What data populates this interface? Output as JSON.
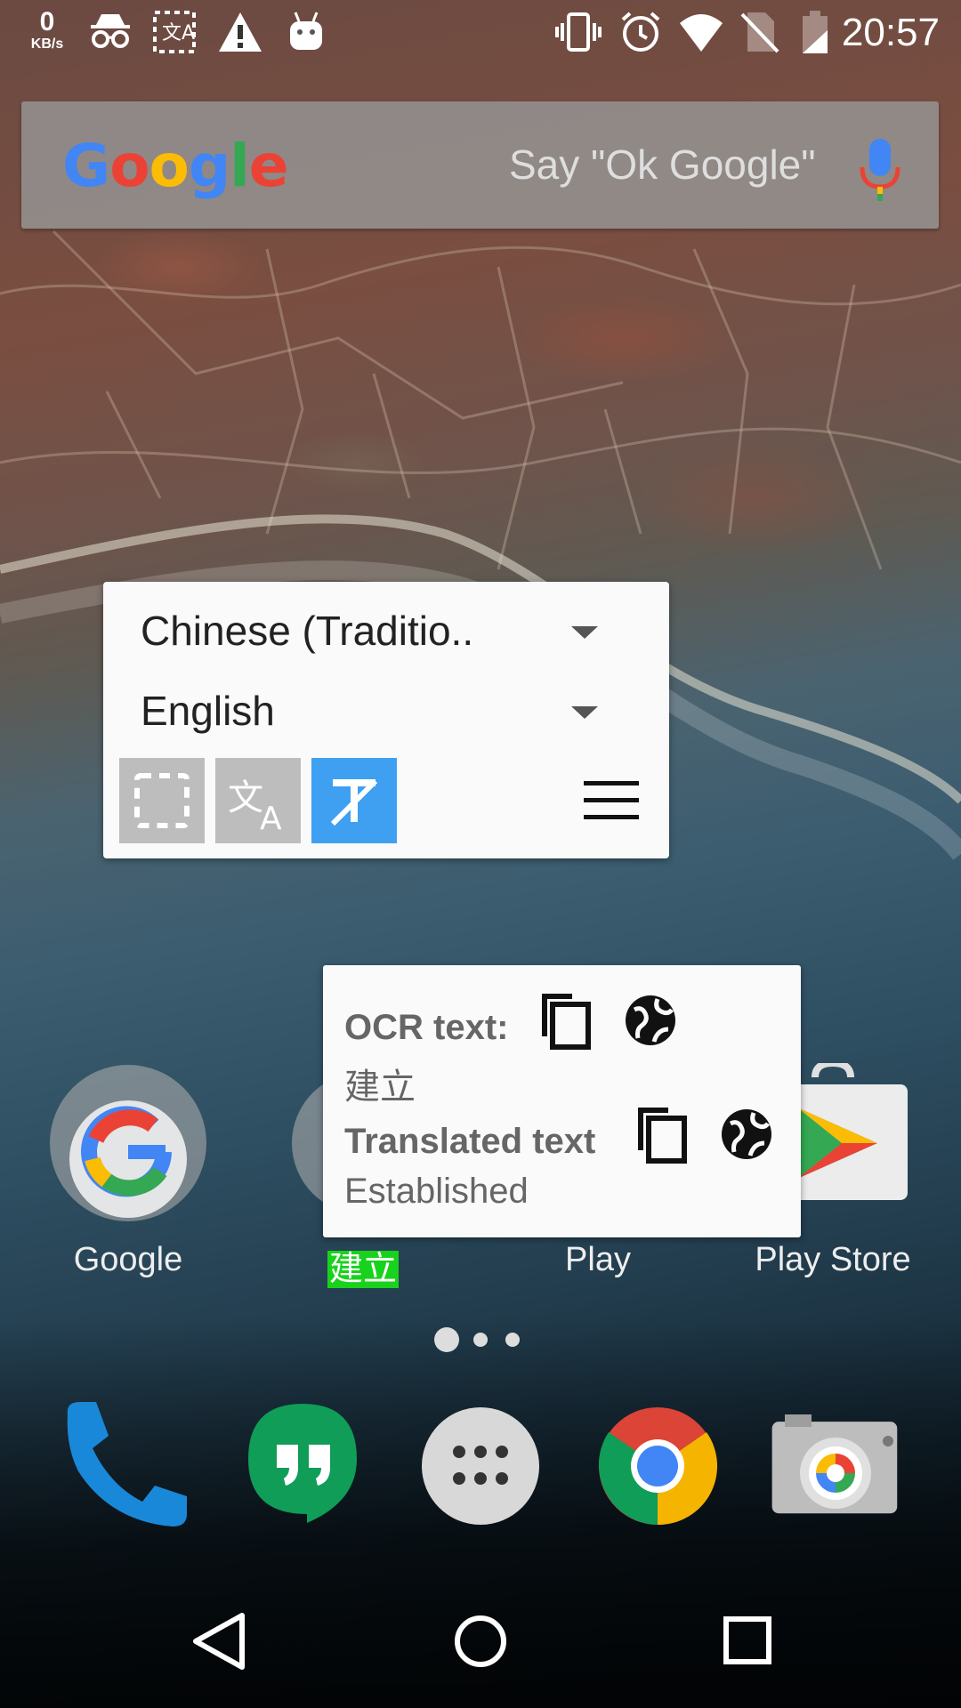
{
  "status_bar": {
    "net_speed_value": "0",
    "net_speed_unit": "KB/s",
    "time": "20:57",
    "left_icons": [
      "incognito-icon",
      "screen-translate-icon",
      "warning-icon",
      "android-icon"
    ],
    "right_icons": [
      "vibrate-icon",
      "alarm-icon",
      "wifi-icon",
      "no-sim-icon",
      "battery-icon"
    ]
  },
  "search_bar": {
    "logo": [
      "G",
      "o",
      "o",
      "g",
      "l",
      "e"
    ],
    "logo_colors": [
      "#4285F4",
      "#EA4335",
      "#FBBC05",
      "#4285F4",
      "#34A853",
      "#EA4335"
    ],
    "hint": "Say \"Ok Google\""
  },
  "translator": {
    "source_language": "Chinese (Traditio..",
    "target_language": "English",
    "accent_color": "#3fa0f2"
  },
  "ocr_popup": {
    "ocr_heading": "OCR text:",
    "ocr_value": "建立",
    "translated_heading": "Translated text",
    "translated_value": "Established"
  },
  "apps": [
    {
      "label": "Google"
    },
    {
      "label": "建立"
    },
    {
      "label": "Play"
    },
    {
      "label": "Play Store"
    }
  ],
  "pager": {
    "pages": 3,
    "current": 1
  },
  "dock": [
    "phone-icon",
    "hangouts-icon",
    "app-drawer-icon",
    "chrome-icon",
    "camera-icon"
  ],
  "nav": [
    "back-button",
    "home-button",
    "recents-button"
  ]
}
